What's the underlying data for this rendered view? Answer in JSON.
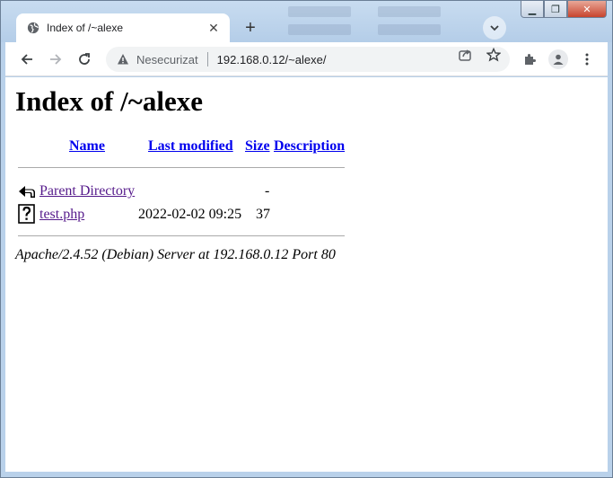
{
  "browser": {
    "tab_title": "Index of /~alexe",
    "security_label": "Nesecurizat",
    "url": "192.168.0.12/~alexe/"
  },
  "page": {
    "heading": "Index of /~alexe",
    "columns": {
      "name": "Name",
      "last_modified": "Last modified",
      "size": "Size",
      "description": "Description"
    },
    "rows": [
      {
        "name": "Parent Directory",
        "last_modified": "",
        "size": "-",
        "description": "",
        "icon": "back-arrow-icon"
      },
      {
        "name": "test.php",
        "last_modified": "2022-02-02 09:25",
        "size": "37",
        "description": "",
        "icon": "unknown-file-icon"
      }
    ],
    "footer": "Apache/2.4.52 (Debian) Server at 192.168.0.12 Port 80"
  },
  "colors": {
    "link": "#0000ee",
    "visited_link": "#551a8b"
  }
}
